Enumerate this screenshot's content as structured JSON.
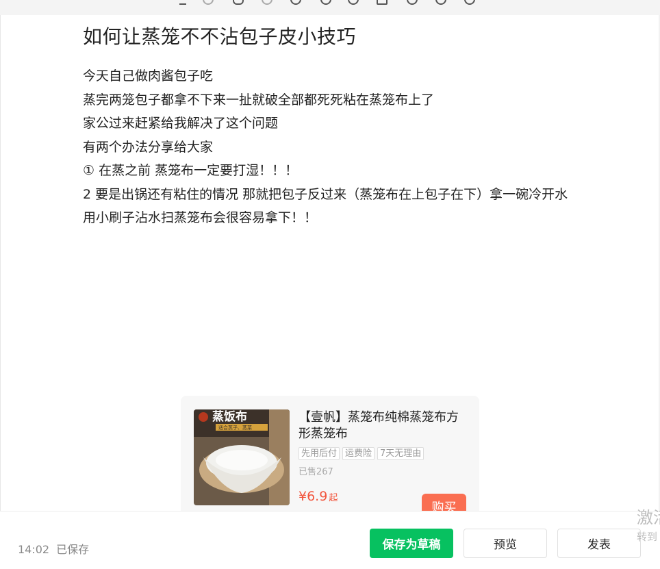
{
  "toolbar": {
    "icons": [
      "format-icon",
      "undo-icon",
      "link-icon",
      "attach-icon",
      "emoji-icon",
      "location-icon",
      "vote-icon",
      "image-icon",
      "video-icon",
      "audio-icon",
      "more-icon"
    ]
  },
  "article": {
    "title": "如何让蒸笼不不沾包子皮小技巧",
    "paragraphs": [
      "今天自己做肉酱包子吃",
      "蒸完两笼包子都拿不下来一扯就破全部都死死粘在蒸笼布上了",
      "家公过来赶紧给我解决了这个问题",
      "有两个办法分享给大家",
      "① 在蒸之前 蒸笼布一定要打湿！！！",
      "2 要是出锅还有粘住的情况 那就把包子反过来（蒸笼布在上包子在下）拿一碗冷开水 用小刷子沾水扫蒸笼布会很容易拿下！！"
    ]
  },
  "product": {
    "image_text": "蒸饭布",
    "image_subtext": "适合蒸子、蒸菜",
    "name": "【壹帆】蒸笼布纯棉蒸笼布方形蒸笼布",
    "tags": [
      "先用后付",
      "运费险",
      "7天无理由"
    ],
    "sold": "已售267",
    "price": "¥6.9",
    "price_suffix": "起",
    "buy_label": "购买",
    "price_color": "#f2553d",
    "buy_color": "#fa6e51"
  },
  "watermark": {
    "line1": "激活",
    "line2": "转到"
  },
  "footer": {
    "time": "14:02",
    "status": "已保存",
    "draft_label": "保存为草稿",
    "preview_label": "预览",
    "publish_label": "发表",
    "accent_color": "#07c160"
  }
}
